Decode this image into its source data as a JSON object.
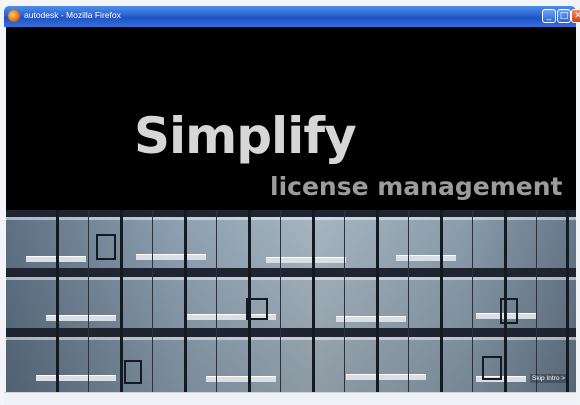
{
  "window": {
    "title": "autodesk - Mozilla Firefox",
    "icon": "firefox-icon",
    "controls": {
      "minimize": "_",
      "maximize": "□",
      "close": "✕"
    }
  },
  "hero": {
    "title": "Simplify",
    "subtitle": "license management"
  },
  "intro": {
    "skip_label": "Skip Intro >"
  },
  "colors": {
    "background": "#000000",
    "title_text": "#d6d6d6",
    "subtitle_text": "#9c9c9c",
    "titlebar": "#2a62d2"
  }
}
